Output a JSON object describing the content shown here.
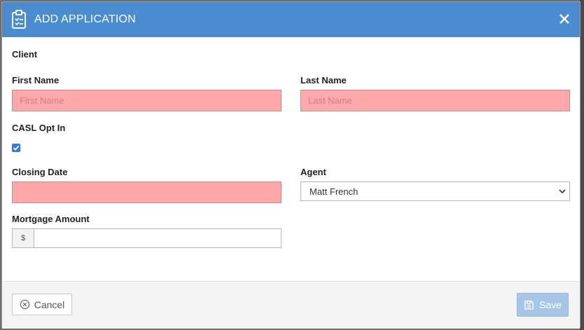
{
  "modal": {
    "title": "ADD APPLICATION",
    "icons": {
      "header": "clipboard-checklist-icon",
      "close": "close-icon"
    }
  },
  "form": {
    "section_label": "Client",
    "first_name": {
      "label": "First Name",
      "placeholder": "First Name",
      "value": ""
    },
    "last_name": {
      "label": "Last Name",
      "placeholder": "Last Name",
      "value": ""
    },
    "casl": {
      "label": "CASL Opt In",
      "checked": true
    },
    "closing_date": {
      "label": "Closing Date",
      "value": ""
    },
    "agent": {
      "label": "Agent",
      "selected": "Matt French"
    },
    "mortgage_amount": {
      "label": "Mortgage Amount",
      "prefix": "$",
      "value": ""
    }
  },
  "footer": {
    "cancel_label": "Cancel",
    "save_label": "Save"
  },
  "colors": {
    "header": "#4a8ccf",
    "invalid_field": "#ffa8ab",
    "save_button": "#a7c6e6"
  }
}
